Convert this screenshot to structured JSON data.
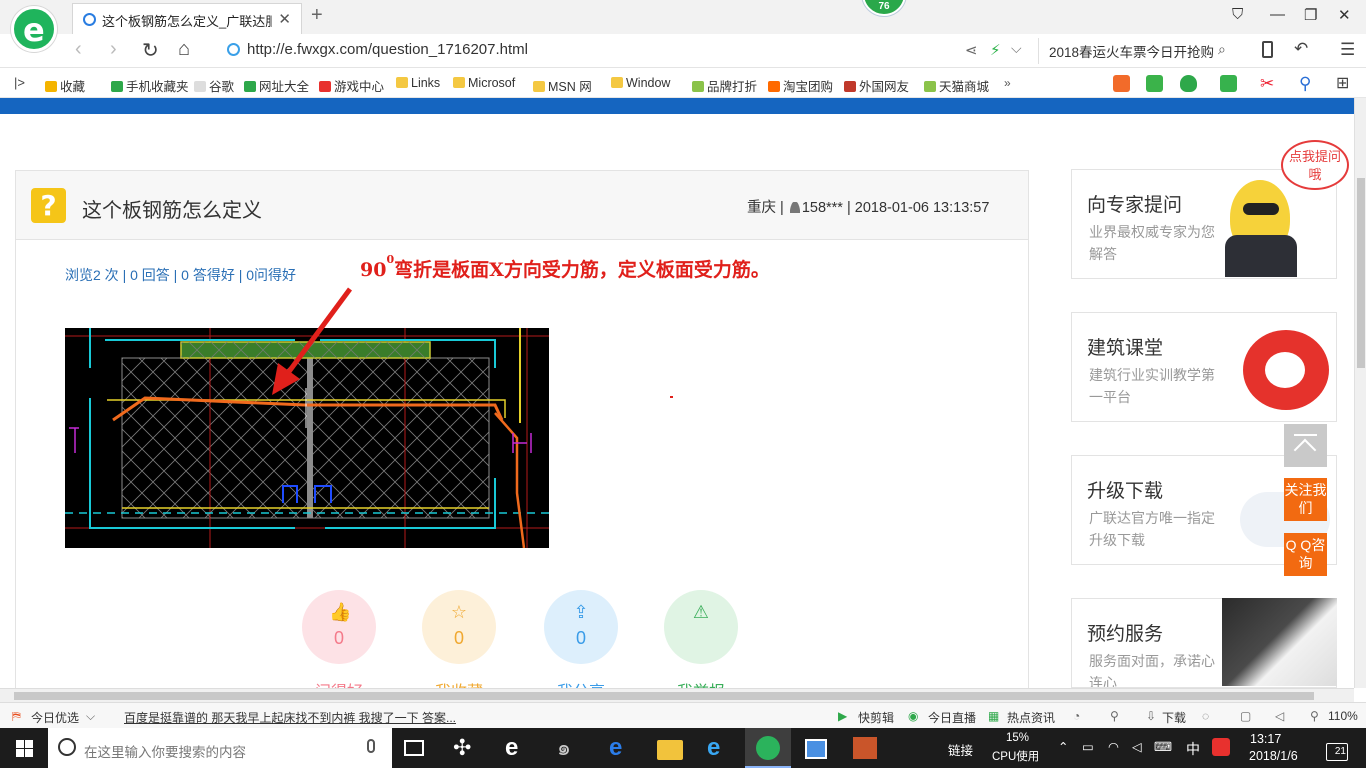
{
  "browser": {
    "tab_title": "这个板钢筋怎么定义_广联达服务新干线",
    "url": "http://e.fwxgx.com/question_1716207.html",
    "badge_count": "76",
    "search_text": "2018春运火车票今日开抢购"
  },
  "favorites": [
    {
      "label": "收藏",
      "icon": "star-icon"
    },
    {
      "label": "手机收藏夹",
      "icon": "phone-icon"
    },
    {
      "label": "谷歌",
      "icon": "page-icon"
    },
    {
      "label": "网址大全",
      "icon": "globe-icon"
    },
    {
      "label": "游戏中心",
      "icon": "game-icon"
    },
    {
      "label": "Links",
      "icon": "folder-icon"
    },
    {
      "label": "Microsof",
      "icon": "folder-icon"
    },
    {
      "label": "MSN 网",
      "icon": "folder-icon"
    },
    {
      "label": "Window",
      "icon": "folder-icon"
    },
    {
      "label": "品牌打折",
      "icon": "leaf-icon"
    },
    {
      "label": "淘宝团购",
      "icon": "taobao-icon"
    },
    {
      "label": "外国网友",
      "icon": "bookmark-icon"
    },
    {
      "label": "天猫商城",
      "icon": "leaf-icon"
    }
  ],
  "question": {
    "title": "这个板钢筋怎么定义",
    "location": "重庆",
    "user": "158***",
    "datetime": "2018-01-06 13:13:57",
    "stats": "浏览2 次 | 0 回答 | 0 答得好 | 0问得好",
    "annotation_prefix": "90",
    "annotation_sup": "0",
    "annotation_rest": "弯折是板面X方向受力筋，定义板面受力筋。"
  },
  "actions": [
    {
      "label": "问得好",
      "count": "0",
      "icon": "thumbs-up-icon",
      "color": "#f47a8a",
      "bg": "#fde2e6"
    },
    {
      "label": "我收藏",
      "count": "0",
      "icon": "star-icon",
      "color": "#f0a830",
      "bg": "#fdf0d9"
    },
    {
      "label": "我分享",
      "count": "0",
      "icon": "share-icon",
      "color": "#3a9ce8",
      "bg": "#ddeffc"
    },
    {
      "label": "我举报",
      "count": "",
      "icon": "warning-icon",
      "color": "#3aae5a",
      "bg": "#e0f4e4"
    }
  ],
  "sidebar": [
    {
      "title": "向专家提问",
      "desc": "业界最权威专家为您解答"
    },
    {
      "title": "建筑课堂",
      "desc": "建筑行业实训教学第一平台"
    },
    {
      "title": "升级下载",
      "desc": "广联达官方唯一指定升级下载"
    },
    {
      "title": "预约服务",
      "desc": "服务面对面，承诺心连心"
    }
  ],
  "bubble": "点我提问哦",
  "float_buttons": {
    "follow": "关注我们",
    "qq": "Q Q咨询"
  },
  "status": {
    "today": "今日优选",
    "news": "百度是挺靠谱的 那天我早上起床找不到内裤 我搜了一下 答案...",
    "kuaijianji": "快剪辑",
    "live": "今日直播",
    "hot": "热点资讯",
    "download": "下载",
    "zoom": "110%"
  },
  "taskbar": {
    "search_placeholder": "在这里输入你要搜索的内容",
    "link": "链接",
    "cpu_percent": "15%",
    "cpu_label": "CPU使用",
    "ime": "中",
    "time": "13:17",
    "date": "2018/1/6",
    "notifications": "21"
  }
}
